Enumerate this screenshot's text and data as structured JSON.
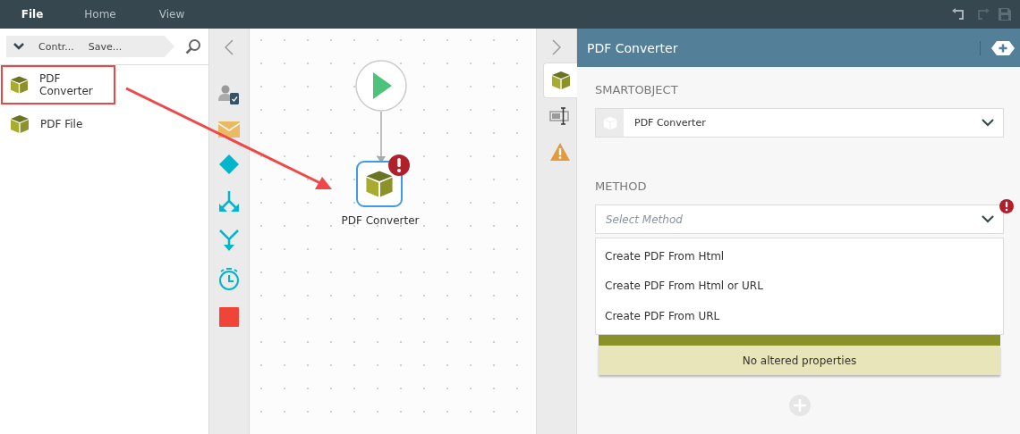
{
  "menu": [
    {
      "label": "File",
      "selected": true
    },
    {
      "label": "Home",
      "selected": false
    },
    {
      "label": "View",
      "selected": false
    }
  ],
  "breadcrumb": [
    "Contr...",
    "Save..."
  ],
  "items": [
    {
      "label": "PDF Converter",
      "highlighted": true
    },
    {
      "label": "PDF File",
      "highlighted": false
    }
  ],
  "canvas": {
    "node": {
      "label": "PDF Converter",
      "error": true
    }
  },
  "side_tabs": [
    {
      "kind": "smartobject",
      "selected": true
    },
    {
      "kind": "form",
      "selected": false
    },
    {
      "kind": "warning",
      "selected": false
    }
  ],
  "panel": {
    "title": "PDF Converter",
    "smartobject_label": "SMARTOBJECT",
    "smartobject_value": "PDF Converter",
    "method_label": "METHOD",
    "method_placeholder": "Select Method",
    "method_error": true,
    "method_options": [
      "Create PDF From Html",
      "Create PDF From Html or URL",
      "Create PDF From URL"
    ],
    "properties_note": "No altered properties"
  }
}
